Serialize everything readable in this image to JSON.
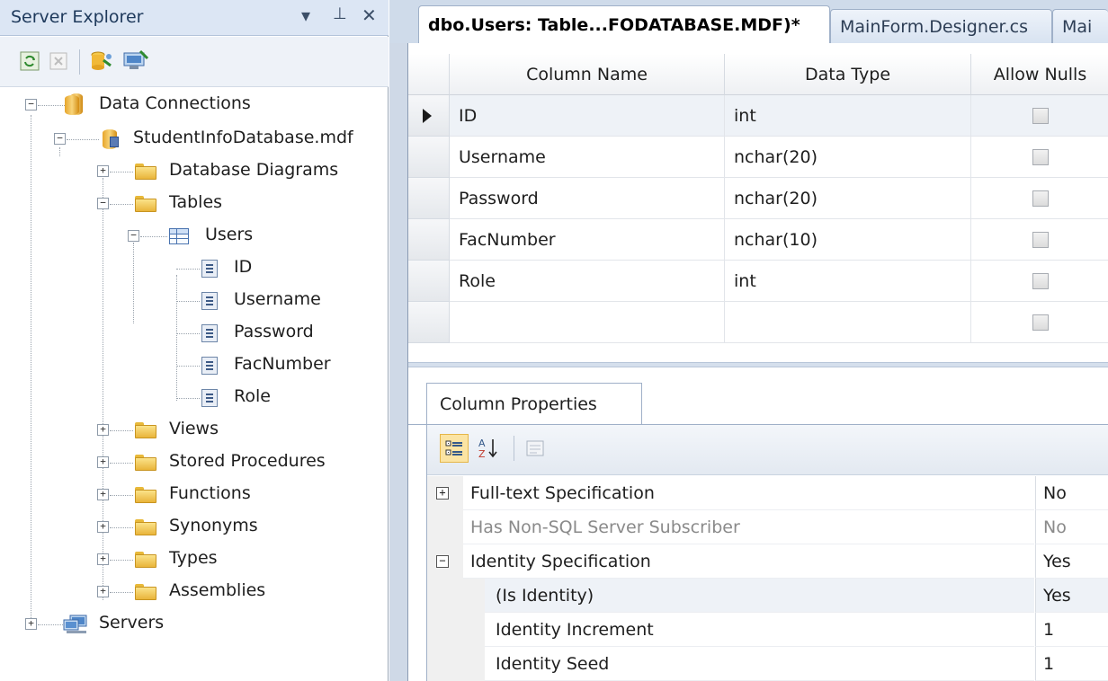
{
  "explorer": {
    "title": "Server Explorer",
    "pin_glyph": "▾",
    "autohide_glyph": "⊥",
    "close_glyph": "✕",
    "toolbar_icons": [
      "refresh-icon",
      "stop-refresh-icon",
      "connect-to-database-icon",
      "connect-to-server-icon"
    ],
    "tree": {
      "data_connections": "Data Connections",
      "database": "StudentInfoDatabase.mdf",
      "database_diagrams": "Database Diagrams",
      "tables": "Tables",
      "users_table": "Users",
      "columns": [
        "ID",
        "Username",
        "Password",
        "FacNumber",
        "Role"
      ],
      "views": "Views",
      "stored_procedures": "Stored Procedures",
      "functions": "Functions",
      "synonyms": "Synonyms",
      "types": "Types",
      "assemblies": "Assemblies",
      "servers": "Servers"
    }
  },
  "tabs": [
    {
      "label": "dbo.Users: Table...FODATABASE.MDF)*",
      "active": true
    },
    {
      "label": "MainForm.Designer.cs",
      "active": false
    },
    {
      "label": "Mai",
      "active": false
    }
  ],
  "grid": {
    "headers": [
      "Column Name",
      "Data Type",
      "Allow Nulls"
    ],
    "rows": [
      {
        "name": "ID",
        "type": "int",
        "allow_nulls": false
      },
      {
        "name": "Username",
        "type": "nchar(20)",
        "allow_nulls": false
      },
      {
        "name": "Password",
        "type": "nchar(20)",
        "allow_nulls": false
      },
      {
        "name": "FacNumber",
        "type": "nchar(10)",
        "allow_nulls": false
      },
      {
        "name": "Role",
        "type": "int",
        "allow_nulls": false
      },
      {
        "name": "",
        "type": "",
        "allow_nulls": false
      }
    ]
  },
  "properties": {
    "tab_label": "Column Properties",
    "rows": [
      {
        "label": "Full-text Specification",
        "value": "No",
        "expander": "+",
        "dim": false
      },
      {
        "label": "Has Non-SQL Server Subscriber",
        "value": "No",
        "expander": "",
        "dim": true
      },
      {
        "label": "Identity Specification",
        "value": "Yes",
        "expander": "−",
        "dim": false
      },
      {
        "label": "(Is Identity)",
        "value": "Yes",
        "expander": "",
        "dim": false
      },
      {
        "label": "Identity Increment",
        "value": "1",
        "expander": "",
        "dim": false
      },
      {
        "label": "Identity Seed",
        "value": "1",
        "expander": "",
        "dim": false
      }
    ]
  }
}
